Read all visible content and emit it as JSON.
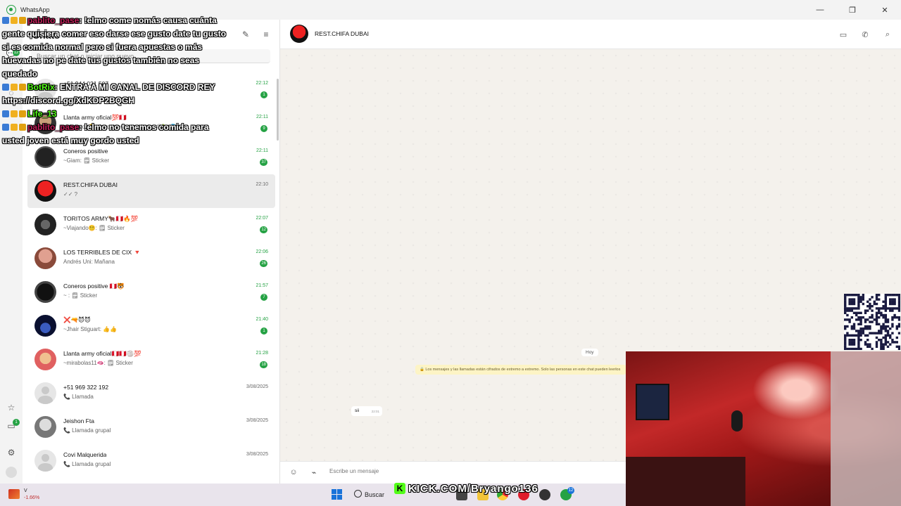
{
  "window": {
    "title": "WhatsApp",
    "controls": [
      "—",
      "❐",
      "✕"
    ]
  },
  "rail": {
    "chats_badge": "12",
    "status_badge": "1"
  },
  "list": {
    "title": "Chats",
    "search_placeholder": "Buscar un chat o iniciar uno nuevo"
  },
  "chats": [
    {
      "name": "+51 944 021 507",
      "preview": "",
      "time": "22:12",
      "unread": "1",
      "time_color": "green"
    },
    {
      "name": "Llanta army oficial💯🇵🇪",
      "preview": "~Viajando😵‍💫: Amor kiero votar leche 😋🍆💦",
      "time": "22:11",
      "unread": "9",
      "time_color": "green"
    },
    {
      "name": "Coneros positive",
      "preview": "~Giam: 🗒 Sticker",
      "time": "22:11",
      "unread": "37",
      "time_color": "green"
    },
    {
      "name": "REST.CHIFA DUBAI",
      "preview": "✓✓ ?",
      "time": "22:10",
      "unread": "",
      "time_color": "grey"
    },
    {
      "name": "TORITOS ARMY🐂🇵🇪🔥💯",
      "preview": "~Viajando😵‍💫: 🗒 Sticker",
      "time": "22:07",
      "unread": "12",
      "time_color": "green"
    },
    {
      "name": "LOS TERRIBLES DE CIX 🔻",
      "preview": "Andrés Uni: Mañana",
      "time": "22:06",
      "unread": "26",
      "time_color": "green"
    },
    {
      "name": "Coneros positive 🇵🇪🐯",
      "preview": "~ : 🗒 Sticker",
      "time": "21:57",
      "unread": "7",
      "time_color": "green"
    },
    {
      "name": "❌🔫😈😈",
      "preview": "~Jhair Stiguart: 👍👍",
      "time": "21:40",
      "unread": "1",
      "time_color": "green"
    },
    {
      "name": "Llanta army oficial🇵🇪🇵🇪🏐💯",
      "preview": "~mirabolas11🫦: 🗒 Sticker",
      "time": "21:28",
      "unread": "18",
      "time_color": "green"
    },
    {
      "name": "+51 969 322 192",
      "preview": "📞 Llamada",
      "time": "3/08/2025",
      "unread": "",
      "time_color": "grey"
    },
    {
      "name": "Jeishon Fta",
      "preview": "📞 Llamada grupal",
      "time": "3/08/2025",
      "unread": "",
      "time_color": "grey"
    },
    {
      "name": "Covi Malquerida",
      "preview": "📞 Llamada grupal",
      "time": "3/08/2025",
      "unread": "",
      "time_color": "grey"
    }
  ],
  "conversation": {
    "name": "REST.CHIFA DUBAI",
    "day_label": "Hoy",
    "e2e_notice": "🔒 Los mensajes y las llamadas están cifrados de extremo a extremo. Solo las personas en este chat pueden leerlos",
    "message_text": "sii",
    "message_time": "22:01",
    "composer_placeholder": "Escribe un mensaje"
  },
  "overlay": {
    "lines": [
      {
        "user": "pablito_pase",
        "user_color": "#c0205a",
        "text": ": !elmo come nomás causa cuánta",
        "badges": true
      },
      {
        "user": "",
        "user_color": "",
        "text": "gente quisiera comer eso darse ese gusto date tu gusto",
        "badges": false
      },
      {
        "user": "",
        "user_color": "",
        "text": "si es comida normal pero si fuera apuestas o más",
        "badges": false
      },
      {
        "user": "",
        "user_color": "",
        "text": "huevadas no pe date tus gustos también no seas",
        "badges": false
      },
      {
        "user": "",
        "user_color": "",
        "text": "quedado",
        "badges": false
      },
      {
        "user": "BotRix",
        "user_color": "#53fc18",
        "text": ": ENTRA A MI CANAL DE DISCORD REY",
        "badges": true
      },
      {
        "user": "",
        "user_color": "",
        "text": "https://discord.gg/XdKDP2BQGH",
        "badges": false
      },
      {
        "user": "Life_13",
        "user_color": "#53fc18",
        "text": "",
        "badges": true
      },
      {
        "user": "pablito_pase",
        "user_color": "#c0205a",
        "text": ": !elmo no tenemos comida para",
        "badges": true
      },
      {
        "user": "",
        "user_color": "",
        "text": "usted joven está muy gordo usted",
        "badges": false
      }
    ]
  },
  "taskbar": {
    "weather_name": "V",
    "weather_value": "-1.66%",
    "search_label": "Buscar",
    "whatsapp_badge": "12"
  },
  "kick": {
    "logo": "K",
    "text": "KICK.COM/Bryango136"
  },
  "colors": {
    "accent": "#25a244",
    "active_row": "#ebebeb",
    "chat_bg": "#f4f1ec",
    "e2e_bg": "#fdf4c5",
    "kick_green": "#53fc18"
  }
}
